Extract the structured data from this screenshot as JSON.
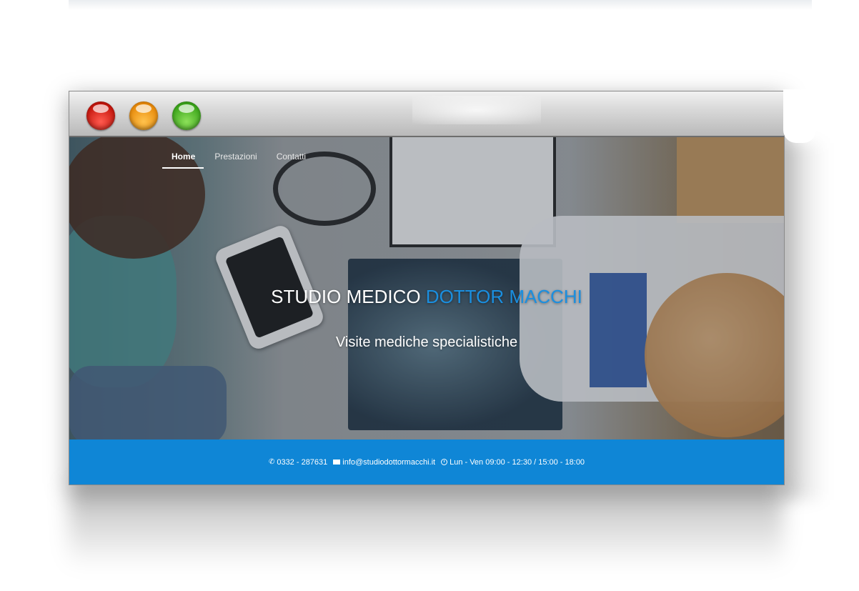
{
  "window": {
    "buttons": [
      "close",
      "minimize",
      "maximize"
    ]
  },
  "nav": {
    "items": [
      "Home",
      "Prestazioni",
      "Contatti"
    ],
    "active": "Home"
  },
  "hero": {
    "title_part1": "STUDIO MEDICO ",
    "title_part2": "DOTTOR MACCHI",
    "subtitle": "Visite mediche specialistiche"
  },
  "footer": {
    "phone": "0332 - 287631",
    "email": "info@studiodottormacchi.it",
    "hours": "Lun - Ven 09:00 - 12:30 / 15:00 - 18:00"
  },
  "colors": {
    "accent": "#1a8fe0",
    "footer_bg": "#0f86d6"
  }
}
